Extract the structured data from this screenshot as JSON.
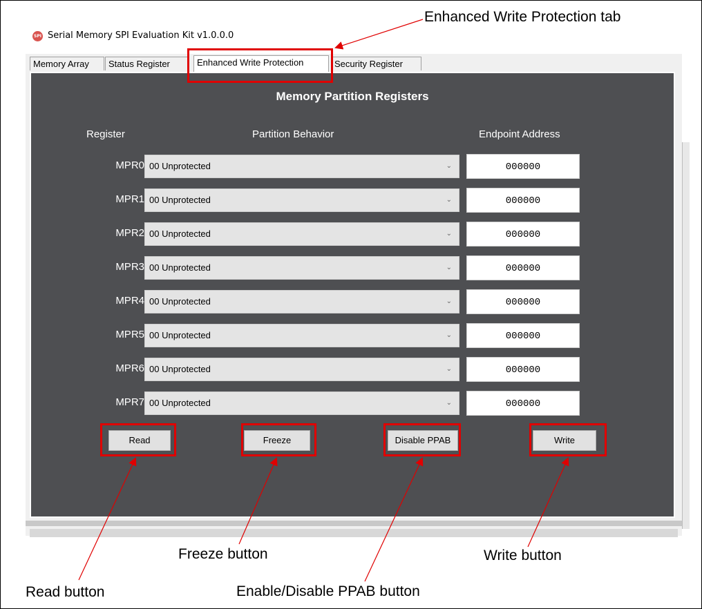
{
  "window": {
    "title": "Serial Memory SPI Evaluation Kit v1.0.0.0",
    "icon_text": "SPI"
  },
  "tabs": [
    {
      "label": "Memory Array"
    },
    {
      "label": "Status Register"
    },
    {
      "label": "Enhanced Write Protection",
      "active": true
    },
    {
      "label": "Security Register"
    }
  ],
  "panel": {
    "title": "Memory Partition Registers",
    "col_register": "Register",
    "col_behavior": "Partition Behavior",
    "col_endpoint": "Endpoint Address"
  },
  "rows": [
    {
      "label": "MPR0",
      "behavior": "00 Unprotected",
      "address": "000000"
    },
    {
      "label": "MPR1",
      "behavior": "00 Unprotected",
      "address": "000000"
    },
    {
      "label": "MPR2",
      "behavior": "00 Unprotected",
      "address": "000000"
    },
    {
      "label": "MPR3",
      "behavior": "00 Unprotected",
      "address": "000000"
    },
    {
      "label": "MPR4",
      "behavior": "00 Unprotected",
      "address": "000000"
    },
    {
      "label": "MPR5",
      "behavior": "00 Unprotected",
      "address": "000000"
    },
    {
      "label": "MPR6",
      "behavior": "00 Unprotected",
      "address": "000000"
    },
    {
      "label": "MPR7",
      "behavior": "00 Unprotected",
      "address": "000000"
    }
  ],
  "buttons": {
    "read": "Read",
    "freeze": "Freeze",
    "ppab": "Disable PPAB",
    "write": "Write"
  },
  "callouts": {
    "tab": "Enhanced Write Protection tab",
    "read": "Read button",
    "freeze": "Freeze button",
    "ppab": "Enable/Disable PPAB button",
    "write": "Write button"
  },
  "colors": {
    "panel_bg": "#4e4f52",
    "highlight": "#e00000"
  }
}
